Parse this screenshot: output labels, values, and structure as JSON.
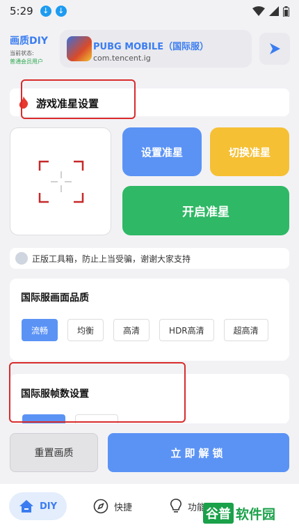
{
  "status_bar": {
    "time": "5:29"
  },
  "header": {
    "brand_title": "画质DIY",
    "brand_status_label": "当前状态:",
    "brand_user_type": "普通会员用户",
    "app_name": "PUBG MOBILE（国际服）",
    "app_package": "com.tencent.ig"
  },
  "crosshair_section": {
    "title": "游戏准星设置",
    "set_label": "设置准星",
    "switch_label": "切换准星",
    "open_label": "开启准星"
  },
  "notice": {
    "text": "正版工具箱，防止上当受骗，谢谢大家支持"
  },
  "quality_section": {
    "title": "国际服画面品质",
    "options": [
      "流畅",
      "均衡",
      "高清",
      "HDR高清",
      "超高清"
    ],
    "selected": "流畅"
  },
  "frame_section": {
    "title": "国际服帧数设置"
  },
  "actions": {
    "reset_label": "重置画质",
    "unlock_label": "立即解锁"
  },
  "tabs": [
    {
      "label": "DIY",
      "icon": "home-icon"
    },
    {
      "label": "快捷",
      "icon": "compass-icon"
    },
    {
      "label": "功能",
      "icon": "bulb-icon"
    }
  ],
  "watermark": {
    "part1": "谷普",
    "part2": "软件园"
  },
  "colors": {
    "primary": "#5b93f5",
    "yellow": "#f5c034",
    "green": "#2fb865",
    "highlight": "#d92b2b"
  }
}
